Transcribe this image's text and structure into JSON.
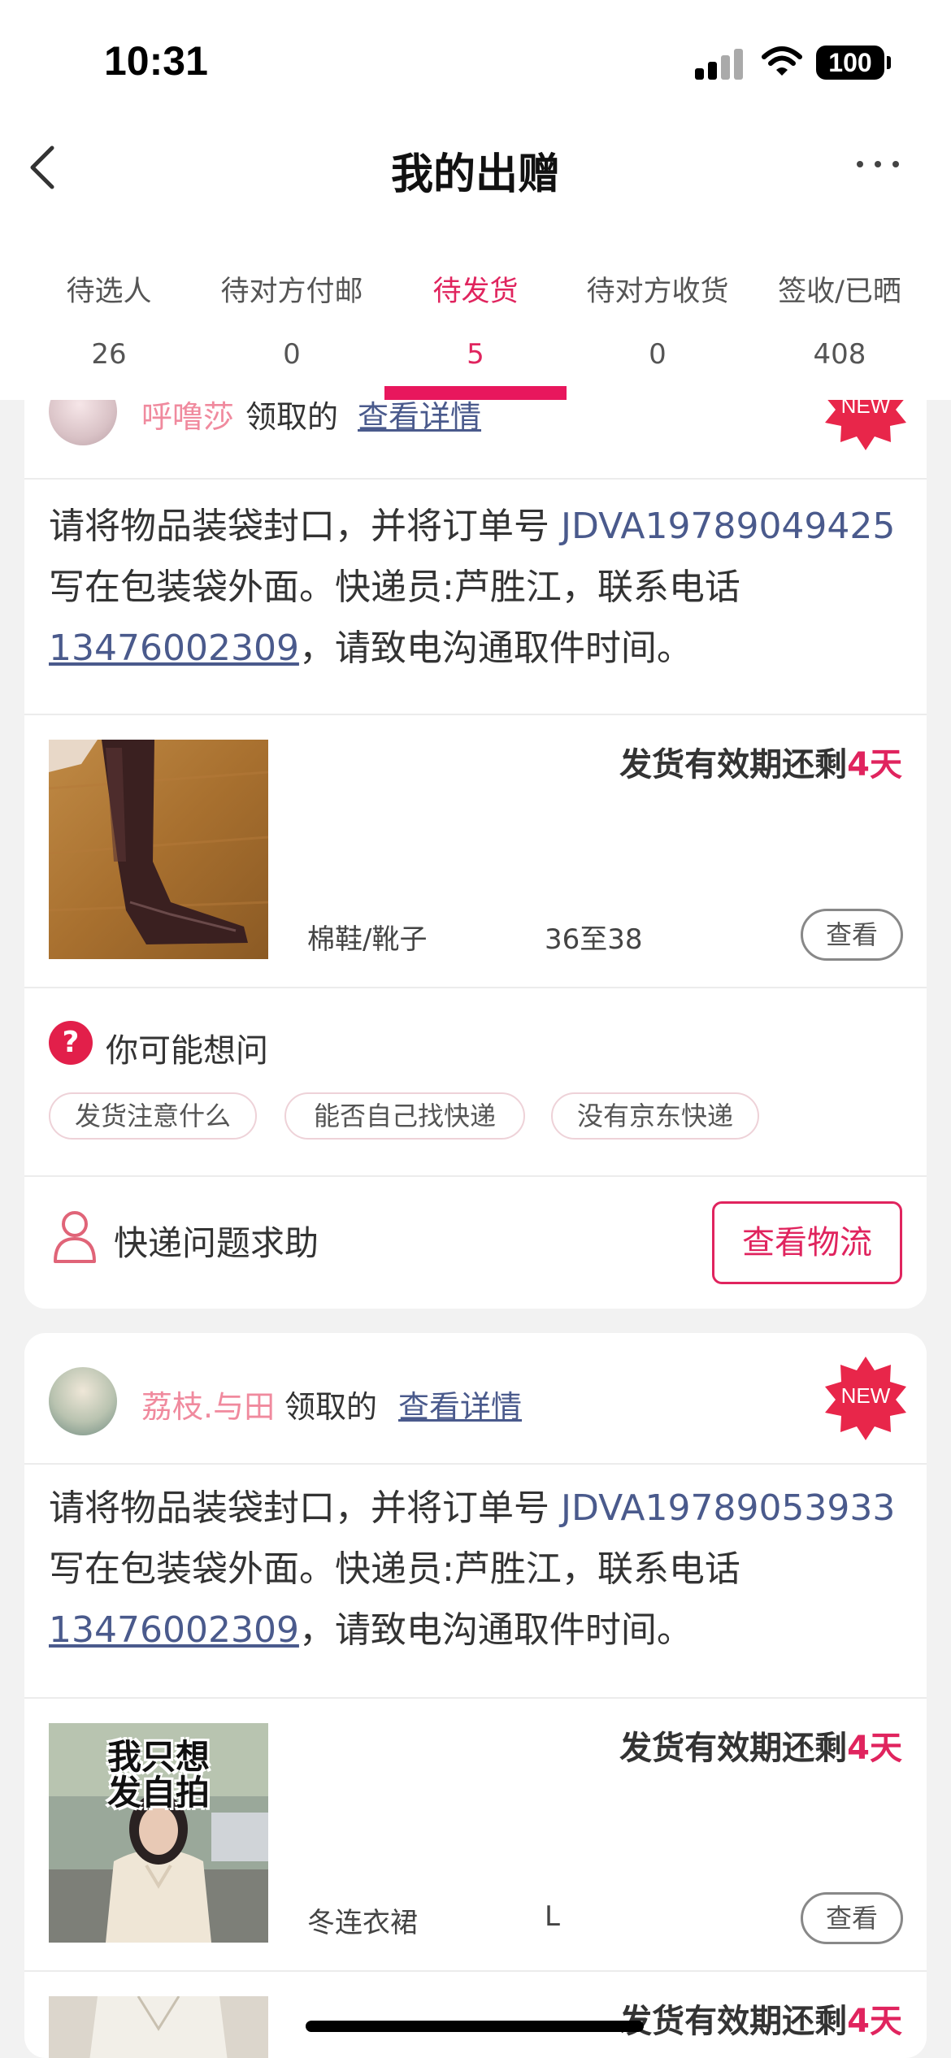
{
  "status": {
    "time": "10:31",
    "battery": "100"
  },
  "nav": {
    "title": "我的出赠"
  },
  "tabs": [
    {
      "label": "待选人",
      "count": "26"
    },
    {
      "label": "待对方付邮",
      "count": "0"
    },
    {
      "label": "待发货",
      "count": "5",
      "active": true
    },
    {
      "label": "待对方收货",
      "count": "0"
    },
    {
      "label": "签收/已晒",
      "count": "408"
    }
  ],
  "common": {
    "claimed": "领取的",
    "view_detail": "查看详情",
    "new_badge": "NEW",
    "deadline_prefix": "发货有效期还剩",
    "deadline_value": "4天",
    "view_button": "查看",
    "instr_before": "请将物品装袋封口，并将订单号 ",
    "instr_middle": " 写在包装袋外面。快递员:芦胜江，联系电话",
    "instr_after": "，请致电沟通取件时间。"
  },
  "orders": [
    {
      "user": "呼噜莎",
      "order_no": "JDVA19789049425",
      "courier_phone": "13476002309",
      "item": {
        "name": "棉鞋/靴子",
        "size": "36至38"
      },
      "faq": {
        "title": "你可能想问",
        "chips": [
          "发货注意什么",
          "能否自己找快递",
          "没有京东快递"
        ]
      },
      "help": {
        "label": "快递问题求助",
        "logistics_button": "查看物流"
      }
    },
    {
      "user": "荔枝.与田",
      "order_no": "JDVA19789053933",
      "courier_phone": "13476002309",
      "item": {
        "name": "冬连衣裙",
        "size": "L",
        "photo_text": "我只想发自拍"
      }
    }
  ],
  "colors": {
    "accent": "#e0245e",
    "link": "#4a5a8c",
    "username": "#f08a9e",
    "background": "#f2f2f2"
  },
  "icons": [
    "back-arrow-icon",
    "more-icon",
    "question-icon",
    "person-icon",
    "signal-icon",
    "wifi-icon",
    "battery-icon"
  ]
}
